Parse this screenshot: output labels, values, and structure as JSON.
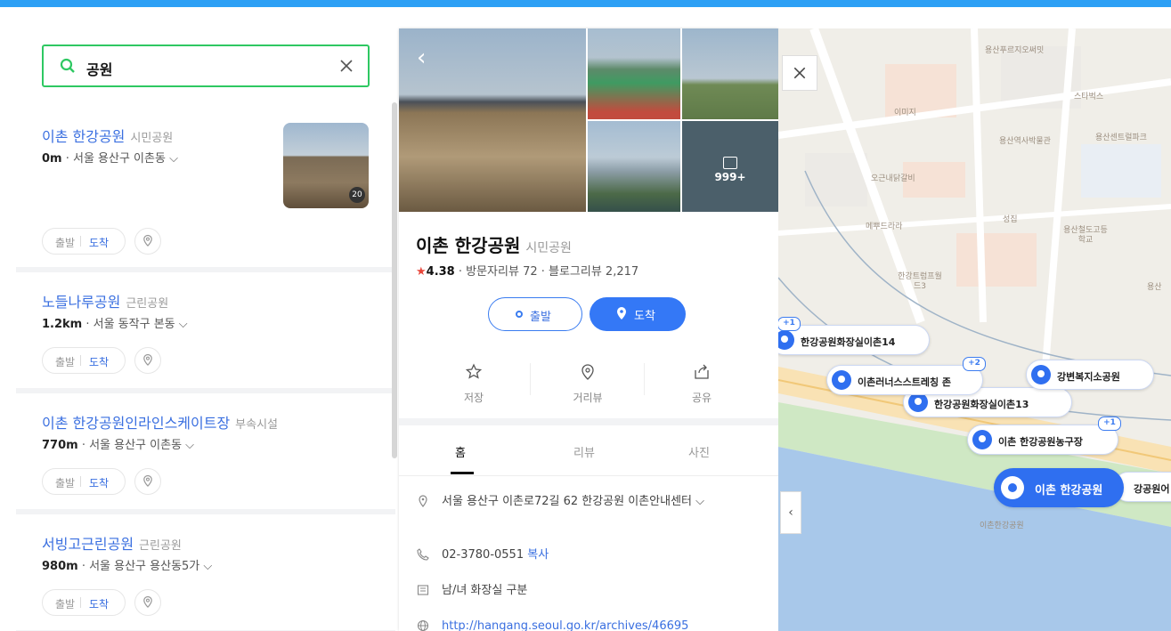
{
  "search": {
    "query": "공원"
  },
  "results": [
    {
      "name": "이촌 한강공원",
      "category": "시민공원",
      "distance": "0m",
      "address": " · 서울 용산구 이촌동 ⌵",
      "start": "출발",
      "arrive": "도착",
      "photo_count": "20"
    },
    {
      "name": "노들나루공원",
      "category": "근린공원",
      "distance": "1.2km",
      "address": " · 서울 동작구 본동 ⌵",
      "start": "출발",
      "arrive": "도착"
    },
    {
      "name": "이촌 한강공원인라인스케이트장",
      "category": "부속시설",
      "distance": "770m",
      "address": " · 서울 용산구 이촌동 ⌵",
      "start": "출발",
      "arrive": "도착"
    },
    {
      "name": "서빙고근린공원",
      "category": "근린공원",
      "distance": "980m",
      "address": " · 서울 용산구 용산동5가 ⌵",
      "start": "출발",
      "arrive": "도착"
    }
  ],
  "detail": {
    "photo_more": "999+",
    "title": "이촌 한강공원",
    "category": "시민공원",
    "rating": "4.38",
    "reviews": " · 방문자리뷰 72 · 블로그리뷰 2,217",
    "start_label": "출발",
    "arrive_label": "도착",
    "actions": {
      "save": "저장",
      "street": "거리뷰",
      "share": "공유"
    },
    "tabs": {
      "home": "홈",
      "review": "리뷰",
      "photo": "사진"
    },
    "address": "서울 용산구 이촌로72길 62 한강공원 이촌안내센터 ⌵",
    "phone": "02-3780-0551",
    "copy": "복사",
    "restroom": "남/녀 화장실 구분",
    "url": "http://hangang.seoul.go.kr/archives/46695"
  },
  "map": {
    "pois": [
      "용산푸르지오써밋",
      "스타벅스",
      "이미지",
      "용산역사박물관",
      "용산센트럴파크",
      "오근내닭갈비",
      "성집",
      "메뿌드라라",
      "용산철도고등학교",
      "한강트럼프월드3",
      "용산",
      "이촌한강공원"
    ],
    "markers": [
      {
        "label": "한강공원화장실이촌14",
        "plus": "+1"
      },
      {
        "label": "이촌러너스스트레칭 존",
        "plus": "+2"
      },
      {
        "label": "한강공원화장실이촌13",
        "plus": ""
      },
      {
        "label": "강변복지소공원",
        "plus": ""
      },
      {
        "label": "이촌 한강공원농구장",
        "plus": "+1"
      },
      {
        "label": "이촌 한강공원",
        "plus": ""
      },
      {
        "label": "강공원어",
        "plus": ""
      }
    ]
  }
}
